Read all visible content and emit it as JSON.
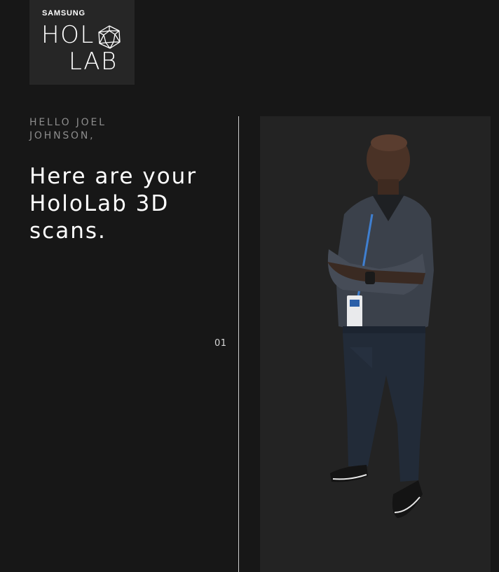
{
  "logo": {
    "brand": "SAMSUNG",
    "line1": "HOLO",
    "line2": "LAB",
    "icon": "geodesic-polyhedron-icon"
  },
  "greeting": "HELLO JOEL JOHNSON,",
  "headline": "Here are your HoloLab 3D scans.",
  "scan": {
    "index": "01",
    "subject": "3d-scan-figure"
  },
  "colors": {
    "background": "#171717",
    "logo_box": "#262626",
    "panel": "#232323",
    "greeting_text": "#8d8d8d",
    "headline_text": "#ffffff"
  }
}
